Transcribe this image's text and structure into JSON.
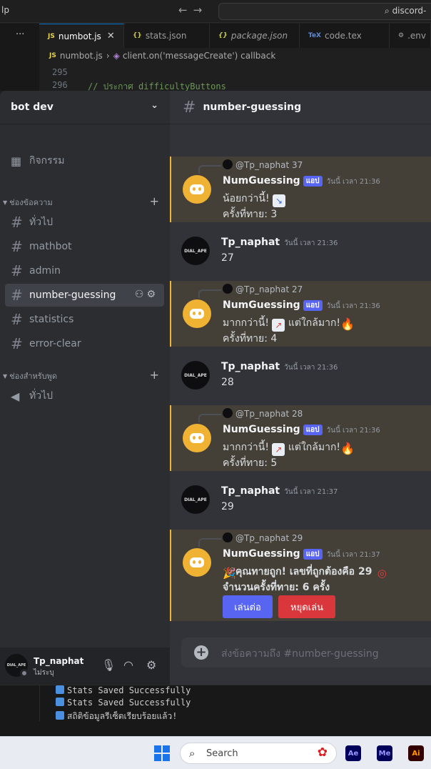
{
  "vscode": {
    "menu_fragment": "lp",
    "nav_arrows": "←→",
    "command_center": "discord-",
    "more": "···",
    "tabs": [
      {
        "icon": "JS",
        "label": "numbot.js",
        "close": "✕"
      },
      {
        "icon": "{}",
        "label": "stats.json"
      },
      {
        "icon": "{}",
        "label": "package.json"
      },
      {
        "icon": "TeX",
        "label": "code.tex"
      },
      {
        "icon": "⚙",
        "label": ".env"
      }
    ],
    "breadcrumb": {
      "file_icon": "JS",
      "file": "numbot.js",
      "separator": "›",
      "symbol": "client.on('messageCreate') callback"
    },
    "editor": [
      {
        "line": "295",
        "code": ""
      },
      {
        "line": "296",
        "code": "// ประกาศ difficultyButtons"
      }
    ]
  },
  "discord": {
    "server_name": "bot dev",
    "events_label": "กิจกรรม",
    "text_category": "ช่องข้อความ",
    "voice_category": "ช่องสำหรับพูด",
    "text_channels": [
      "ทั่วไป",
      "mathbot",
      "admin",
      "number-guessing",
      "statistics",
      "error-clear"
    ],
    "voice_channels": [
      "ทั่วไป"
    ],
    "active_channel": "number-guessing",
    "user": {
      "name": "Tp_naphat",
      "status": "ไม่ระบุ",
      "avatar_text": "DIAL_APE"
    },
    "messages": [
      {
        "reply_to": "@Tp_naphat 37",
        "author": "NumGuessing",
        "tag": "แอป",
        "time": "วันนี้ เวลา 21:36",
        "line1": "น้อยกว่านี้!",
        "line2": "ครั้งที่ทาย: 3"
      },
      {
        "author": "Tp_naphat",
        "time": "วันนี้ เวลา 21:36",
        "line1": "27"
      },
      {
        "reply_to": "@Tp_naphat 27",
        "author": "NumGuessing",
        "tag": "แอป",
        "time": "วันนี้ เวลา 21:36",
        "line1a": "มากกว่านี้!",
        "line1b": "แต่ใกล้มาก!",
        "line2": "ครั้งที่ทาย: 4"
      },
      {
        "author": "Tp_naphat",
        "time": "วันนี้ เวลา 21:36",
        "line1": "28"
      },
      {
        "reply_to": "@Tp_naphat 28",
        "author": "NumGuessing",
        "tag": "แอป",
        "time": "วันนี้ เวลา 21:36",
        "line1a": "มากกว่านี้!",
        "line1b": "แต่ใกล้มาก!",
        "line2": "ครั้งที่ทาย: 5"
      },
      {
        "author": "Tp_naphat",
        "time": "วันนี้ เวลา 21:37",
        "line1": "29"
      },
      {
        "reply_to": "@Tp_naphat 29",
        "author": "NumGuessing",
        "tag": "แอป",
        "time": "วันนี้ เวลา 21:37",
        "line1": "คุณทายถูก! เลขที่ถูกต้องคือ 29",
        "line2": "จำนวนครั้งที่ทาย: 6 ครั้ง",
        "button_play": "เล่นต่อ",
        "button_stop": "หยุดเล่น"
      }
    ],
    "composer_placeholder": "ส่งข้อความถึง #number-guessing"
  },
  "terminal": [
    "Stats Saved Successfully",
    "Stats Saved Successfully",
    "สถิติข้อมูลรีเซ็ตเรียบร้อยแล้ว!"
  ],
  "taskbar": {
    "search_label": "Search",
    "apps": [
      "Ae",
      "Me",
      "Ai"
    ]
  },
  "colors": {
    "accent": "#5865f2",
    "mention_bar": "#f0b232",
    "danger": "#da373c"
  }
}
